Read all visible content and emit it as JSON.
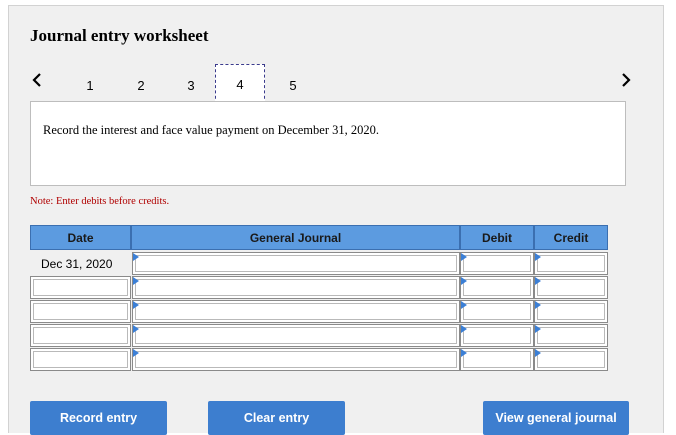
{
  "worksheet": {
    "title": "Journal entry worksheet",
    "pages": [
      "1",
      "2",
      "3",
      "4",
      "5"
    ],
    "active_page": "4",
    "prompt": "Record the interest and face value payment on December 31, 2020.",
    "note": "Note: Enter debits before credits."
  },
  "journal": {
    "headers": {
      "date": "Date",
      "account": "General Journal",
      "debit": "Debit",
      "credit": "Credit"
    },
    "rows": [
      {
        "date": "Dec 31, 2020",
        "account": "",
        "debit": "",
        "credit": ""
      },
      {
        "date": "",
        "account": "",
        "debit": "",
        "credit": ""
      },
      {
        "date": "",
        "account": "",
        "debit": "",
        "credit": ""
      },
      {
        "date": "",
        "account": "",
        "debit": "",
        "credit": ""
      },
      {
        "date": "",
        "account": "",
        "debit": "",
        "credit": ""
      }
    ]
  },
  "buttons": {
    "record": "Record entry",
    "clear": "Clear entry",
    "view": "View general journal"
  },
  "colors": {
    "header_blue": "#5c9be0",
    "button_blue": "#3d7ecf",
    "note_red": "#b00000"
  },
  "icons": {
    "prev": "chevron-left-icon",
    "next": "chevron-right-icon",
    "cell_marker": "triangle-marker-icon"
  }
}
